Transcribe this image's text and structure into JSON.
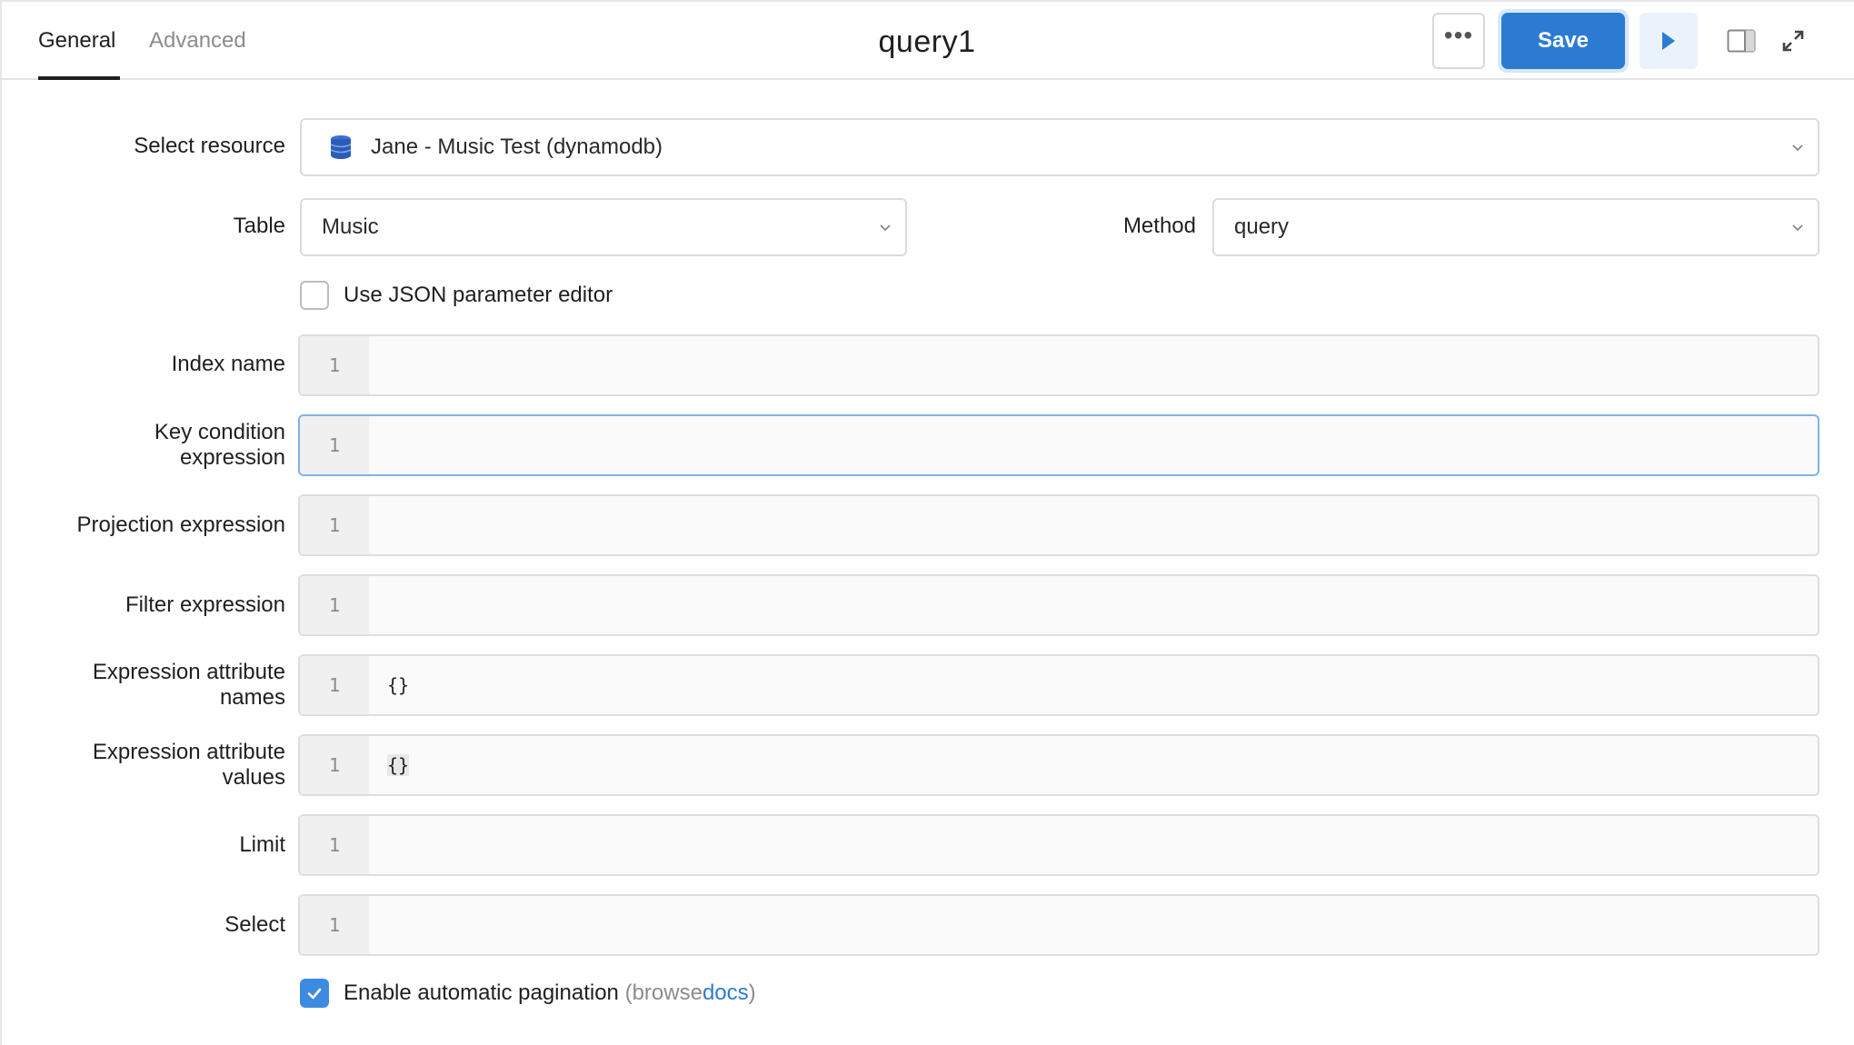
{
  "header": {
    "tabs": [
      {
        "label": "General",
        "active": true
      },
      {
        "label": "Advanced",
        "active": false
      }
    ],
    "title": "query1",
    "more_label": "•••",
    "save_label": "Save",
    "icons": [
      "more-horizontal-icon",
      "play-icon",
      "side-panel-icon",
      "expand-icon"
    ],
    "accent_color": "#2b7bd3"
  },
  "form": {
    "resource": {
      "label": "Select resource",
      "value": "Jane - Music Test (dynamodb)",
      "icon": "dynamodb-database-icon"
    },
    "table": {
      "label": "Table",
      "value": "Music"
    },
    "method": {
      "label": "Method",
      "value": "query"
    },
    "json_editor": {
      "label": "Use JSON parameter editor",
      "checked": false
    },
    "fields": [
      {
        "label": "Index name",
        "line": "1",
        "value": ""
      },
      {
        "label_line1": "Key condition",
        "label_line2": "expression",
        "line": "1",
        "value": "",
        "focused": true
      },
      {
        "label": "Projection expression",
        "line": "1",
        "value": ""
      },
      {
        "label": "Filter expression",
        "line": "1",
        "value": ""
      },
      {
        "label_line1": "Expression attribute",
        "label_line2": "names",
        "line": "1",
        "value": "{}"
      },
      {
        "label_line1": "Expression attribute",
        "label_line2": "values",
        "line": "1",
        "value": "{}"
      },
      {
        "label": "Limit",
        "line": "1",
        "value": ""
      },
      {
        "label": "Select",
        "line": "1",
        "value": ""
      }
    ],
    "pagination": {
      "label": "Enable automatic pagination",
      "paren_open": "(",
      "browse": "browse",
      "docs": "docs",
      "paren_close": ")",
      "checked": true
    }
  }
}
